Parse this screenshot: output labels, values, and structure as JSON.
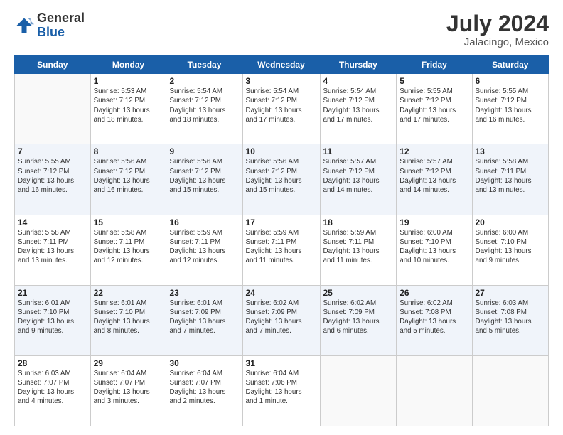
{
  "logo": {
    "general": "General",
    "blue": "Blue"
  },
  "title": "July 2024",
  "location": "Jalacingo, Mexico",
  "days_header": [
    "Sunday",
    "Monday",
    "Tuesday",
    "Wednesday",
    "Thursday",
    "Friday",
    "Saturday"
  ],
  "weeks": [
    [
      {
        "day": "",
        "info": ""
      },
      {
        "day": "1",
        "info": "Sunrise: 5:53 AM\nSunset: 7:12 PM\nDaylight: 13 hours\nand 18 minutes."
      },
      {
        "day": "2",
        "info": "Sunrise: 5:54 AM\nSunset: 7:12 PM\nDaylight: 13 hours\nand 18 minutes."
      },
      {
        "day": "3",
        "info": "Sunrise: 5:54 AM\nSunset: 7:12 PM\nDaylight: 13 hours\nand 17 minutes."
      },
      {
        "day": "4",
        "info": "Sunrise: 5:54 AM\nSunset: 7:12 PM\nDaylight: 13 hours\nand 17 minutes."
      },
      {
        "day": "5",
        "info": "Sunrise: 5:55 AM\nSunset: 7:12 PM\nDaylight: 13 hours\nand 17 minutes."
      },
      {
        "day": "6",
        "info": "Sunrise: 5:55 AM\nSunset: 7:12 PM\nDaylight: 13 hours\nand 16 minutes."
      }
    ],
    [
      {
        "day": "7",
        "info": "Sunrise: 5:55 AM\nSunset: 7:12 PM\nDaylight: 13 hours\nand 16 minutes."
      },
      {
        "day": "8",
        "info": "Sunrise: 5:56 AM\nSunset: 7:12 PM\nDaylight: 13 hours\nand 16 minutes."
      },
      {
        "day": "9",
        "info": "Sunrise: 5:56 AM\nSunset: 7:12 PM\nDaylight: 13 hours\nand 15 minutes."
      },
      {
        "day": "10",
        "info": "Sunrise: 5:56 AM\nSunset: 7:12 PM\nDaylight: 13 hours\nand 15 minutes."
      },
      {
        "day": "11",
        "info": "Sunrise: 5:57 AM\nSunset: 7:12 PM\nDaylight: 13 hours\nand 14 minutes."
      },
      {
        "day": "12",
        "info": "Sunrise: 5:57 AM\nSunset: 7:12 PM\nDaylight: 13 hours\nand 14 minutes."
      },
      {
        "day": "13",
        "info": "Sunrise: 5:58 AM\nSunset: 7:11 PM\nDaylight: 13 hours\nand 13 minutes."
      }
    ],
    [
      {
        "day": "14",
        "info": "Sunrise: 5:58 AM\nSunset: 7:11 PM\nDaylight: 13 hours\nand 13 minutes."
      },
      {
        "day": "15",
        "info": "Sunrise: 5:58 AM\nSunset: 7:11 PM\nDaylight: 13 hours\nand 12 minutes."
      },
      {
        "day": "16",
        "info": "Sunrise: 5:59 AM\nSunset: 7:11 PM\nDaylight: 13 hours\nand 12 minutes."
      },
      {
        "day": "17",
        "info": "Sunrise: 5:59 AM\nSunset: 7:11 PM\nDaylight: 13 hours\nand 11 minutes."
      },
      {
        "day": "18",
        "info": "Sunrise: 5:59 AM\nSunset: 7:11 PM\nDaylight: 13 hours\nand 11 minutes."
      },
      {
        "day": "19",
        "info": "Sunrise: 6:00 AM\nSunset: 7:10 PM\nDaylight: 13 hours\nand 10 minutes."
      },
      {
        "day": "20",
        "info": "Sunrise: 6:00 AM\nSunset: 7:10 PM\nDaylight: 13 hours\nand 9 minutes."
      }
    ],
    [
      {
        "day": "21",
        "info": "Sunrise: 6:01 AM\nSunset: 7:10 PM\nDaylight: 13 hours\nand 9 minutes."
      },
      {
        "day": "22",
        "info": "Sunrise: 6:01 AM\nSunset: 7:10 PM\nDaylight: 13 hours\nand 8 minutes."
      },
      {
        "day": "23",
        "info": "Sunrise: 6:01 AM\nSunset: 7:09 PM\nDaylight: 13 hours\nand 7 minutes."
      },
      {
        "day": "24",
        "info": "Sunrise: 6:02 AM\nSunset: 7:09 PM\nDaylight: 13 hours\nand 7 minutes."
      },
      {
        "day": "25",
        "info": "Sunrise: 6:02 AM\nSunset: 7:09 PM\nDaylight: 13 hours\nand 6 minutes."
      },
      {
        "day": "26",
        "info": "Sunrise: 6:02 AM\nSunset: 7:08 PM\nDaylight: 13 hours\nand 5 minutes."
      },
      {
        "day": "27",
        "info": "Sunrise: 6:03 AM\nSunset: 7:08 PM\nDaylight: 13 hours\nand 5 minutes."
      }
    ],
    [
      {
        "day": "28",
        "info": "Sunrise: 6:03 AM\nSunset: 7:07 PM\nDaylight: 13 hours\nand 4 minutes."
      },
      {
        "day": "29",
        "info": "Sunrise: 6:04 AM\nSunset: 7:07 PM\nDaylight: 13 hours\nand 3 minutes."
      },
      {
        "day": "30",
        "info": "Sunrise: 6:04 AM\nSunset: 7:07 PM\nDaylight: 13 hours\nand 2 minutes."
      },
      {
        "day": "31",
        "info": "Sunrise: 6:04 AM\nSunset: 7:06 PM\nDaylight: 13 hours\nand 1 minute."
      },
      {
        "day": "",
        "info": ""
      },
      {
        "day": "",
        "info": ""
      },
      {
        "day": "",
        "info": ""
      }
    ]
  ]
}
